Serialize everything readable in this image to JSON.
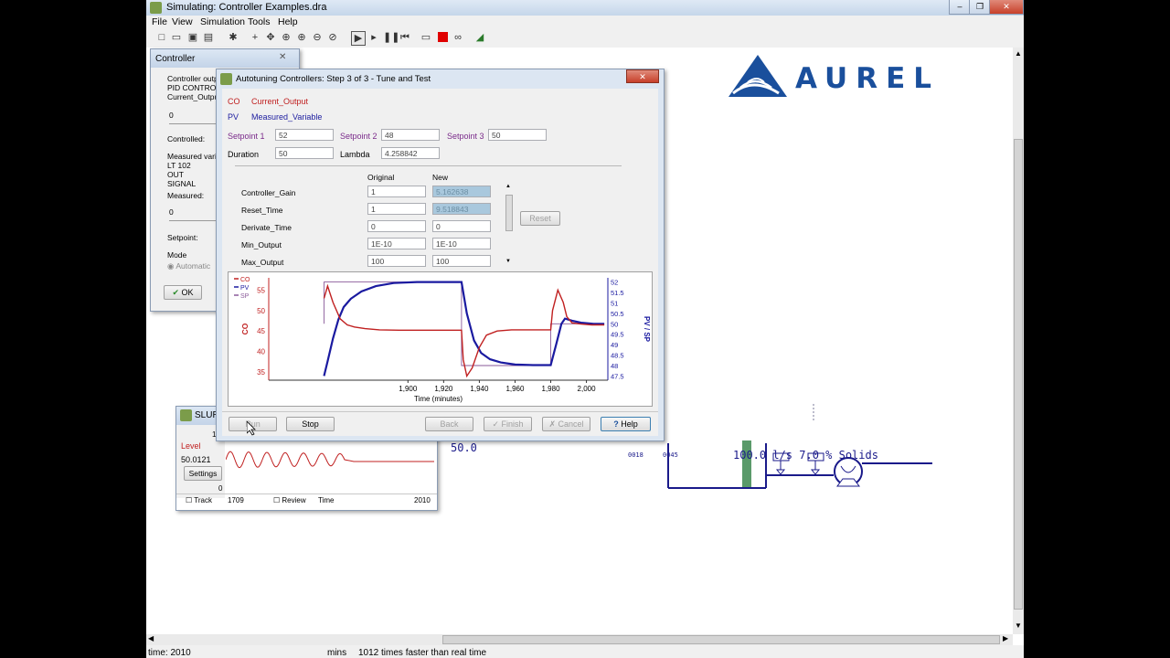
{
  "window": {
    "title": "Simulating: Controller Examples.dra"
  },
  "menu": [
    "File",
    "View",
    "Simulation",
    "Tools",
    "Help"
  ],
  "logo": {
    "text": "AUREL",
    "color": "#1a4f9c"
  },
  "controller_panel": {
    "title": "Controller",
    "lines": [
      "Controller output:",
      "PID CONTROL",
      "Current_Output"
    ],
    "output_value": "0",
    "controlled_label": "Controlled:",
    "measured_var_label": "Measured variable:",
    "measured_var_lines": [
      "LT 102",
      "OUT",
      "SIGNAL"
    ],
    "measured_label": "Measured:",
    "measured_value": "0",
    "setpoint_label": "Setpoint:",
    "mode_label": "Mode",
    "mode_value": "Automatic",
    "ok_label": "OK"
  },
  "slurry_panel": {
    "title": "SLURRY",
    "level_label": "Level",
    "level_value": "50.0121",
    "settings_label": "Settings",
    "axis_zero": "0",
    "axis_one": "1",
    "track_label": "Track",
    "track_start": "1709",
    "review_label": "Review",
    "time_label": "Time",
    "time_end": "2010"
  },
  "flowsheet": {
    "tank_value": "50.0",
    "stream_label": "100.0 l/s 7.0 % Solids",
    "tag1": "0018",
    "tag2": "0045"
  },
  "dialog": {
    "title": "Autotuning Controllers: Step 3 of 3 - Tune and Test",
    "co_tag": "CO",
    "co_name": "Current_Output",
    "pv_tag": "PV",
    "pv_name": "Measured_Variable",
    "setpoint1_label": "Setpoint 1",
    "setpoint1": "52",
    "setpoint2_label": "Setpoint 2",
    "setpoint2": "48",
    "setpoint3_label": "Setpoint 3",
    "setpoint3": "50",
    "duration_label": "Duration",
    "duration": "50",
    "lambda_label": "Lambda",
    "lambda": "4.258842",
    "col_original": "Original",
    "col_new": "New",
    "params": [
      {
        "name": "Controller_Gain",
        "original": "1",
        "new": "5.162638"
      },
      {
        "name": "Reset_Time",
        "original": "1",
        "new": "9.518843"
      },
      {
        "name": "Derivate_Time",
        "original": "0",
        "new": "0"
      },
      {
        "name": "Min_Output",
        "original": "1E-10",
        "new": "1E-10"
      },
      {
        "name": "Max_Output",
        "original": "100",
        "new": "100"
      }
    ],
    "reset_label": "Reset",
    "buttons": {
      "run": "Run",
      "stop": "Stop",
      "back": "Back",
      "finish": "Finish",
      "cancel": "Cancel",
      "help": "Help"
    }
  },
  "chart_data": {
    "type": "line",
    "xlabel": "Time (minutes)",
    "ylabel_left": "CO",
    "ylabel_right": "PV / SP",
    "xlim": [
      1822,
      2012
    ],
    "x_ticks": [
      "1,900",
      "1,920",
      "1,940",
      "1,960",
      "1,980",
      "2,000"
    ],
    "x_tick_values": [
      1900,
      1920,
      1940,
      1960,
      1980,
      2000
    ],
    "y_left_ticks": [
      "35",
      "40",
      "45",
      "50",
      "55"
    ],
    "y_left_values": [
      35,
      40,
      45,
      50,
      55
    ],
    "ylim_left": [
      33,
      58
    ],
    "y_right_ticks": [
      "52",
      "51.5",
      "51",
      "50.5",
      "50",
      "49.5",
      "49",
      "48.5",
      "48",
      "47.5"
    ],
    "y_right_values": [
      52,
      51.5,
      51,
      50.5,
      50,
      49.5,
      49,
      48.5,
      48,
      47.5
    ],
    "ylim_right": [
      47.3,
      52.2
    ],
    "legend": [
      "CO",
      "PV",
      "SP"
    ],
    "legend_position": "top-left",
    "series": [
      {
        "name": "CO",
        "axis": "left",
        "color": "#c02020",
        "x": [
          1853,
          1855,
          1858,
          1862,
          1866,
          1870,
          1876,
          1884,
          1895,
          1910,
          1930,
          1931,
          1933,
          1936,
          1940,
          1944,
          1950,
          1958,
          1968,
          1980,
          1981,
          1984,
          1987,
          1989,
          1992,
          1997,
          2003,
          2010
        ],
        "y": [
          53,
          56,
          52,
          48,
          46.5,
          46,
          45.6,
          45.3,
          45.2,
          45.2,
          45.2,
          38,
          34,
          36,
          41,
          44,
          45,
          45.3,
          45.3,
          45.3,
          50,
          55,
          52,
          48.5,
          47,
          46.7,
          46.5,
          46.5
        ]
      },
      {
        "name": "PV",
        "axis": "right",
        "color": "#1a1aa0",
        "x": [
          1853,
          1855,
          1858,
          1861,
          1864,
          1868,
          1874,
          1882,
          1892,
          1905,
          1930,
          1933,
          1937,
          1941,
          1946,
          1952,
          1960,
          1970,
          1980,
          1983,
          1986,
          1988,
          1992,
          1997,
          2004,
          2010
        ],
        "y": [
          47.5,
          48.2,
          49.3,
          50.2,
          50.8,
          51.2,
          51.55,
          51.8,
          51.95,
          52,
          52,
          50.5,
          49.2,
          48.6,
          48.3,
          48.15,
          48.05,
          48.02,
          48.02,
          49,
          50,
          50.25,
          50.15,
          50.05,
          50,
          50
        ]
      },
      {
        "name": "SP",
        "axis": "right",
        "color": "#8a5a9a",
        "x": [
          1853,
          1853,
          1930,
          1930,
          1980,
          1980,
          2010
        ],
        "y": [
          50,
          52,
          52,
          48,
          48,
          50,
          50
        ]
      }
    ]
  },
  "status": {
    "time": "time: 2010",
    "units": "mins",
    "speed": "1012 times faster than real time"
  }
}
